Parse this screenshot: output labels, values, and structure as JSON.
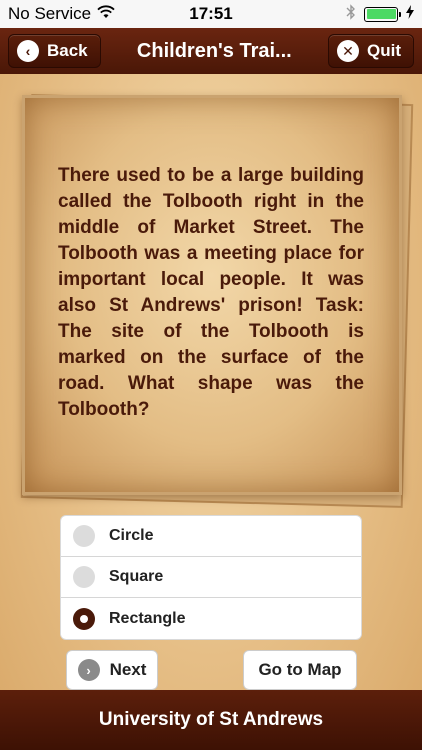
{
  "status_bar": {
    "carrier": "No Service",
    "time": "17:51",
    "icons": [
      "wifi-icon",
      "bluetooth-icon",
      "battery-icon",
      "charging-bolt-icon"
    ]
  },
  "nav": {
    "back_label": "Back",
    "title": "Children's Trai...",
    "quit_label": "Quit"
  },
  "question": {
    "text": "There used to be a large building called the Tolbooth right in the middle of Market Street. The Tolbooth was a meeting place for important local people. It was also St Andrews' prison! Task: The site of the Tolbooth is marked on the surface of the road. What shape was the Tolbooth?"
  },
  "options": [
    {
      "label": "Circle",
      "selected": false
    },
    {
      "label": "Square",
      "selected": false
    },
    {
      "label": "Rectangle",
      "selected": true
    }
  ],
  "buttons": {
    "next_label": "Next",
    "map_label": "Go to Map"
  },
  "footer": {
    "text": "University of St Andrews"
  },
  "colors": {
    "accent": "#4a1707",
    "text_dark": "#4a1a0a",
    "battery": "#4cd964"
  }
}
